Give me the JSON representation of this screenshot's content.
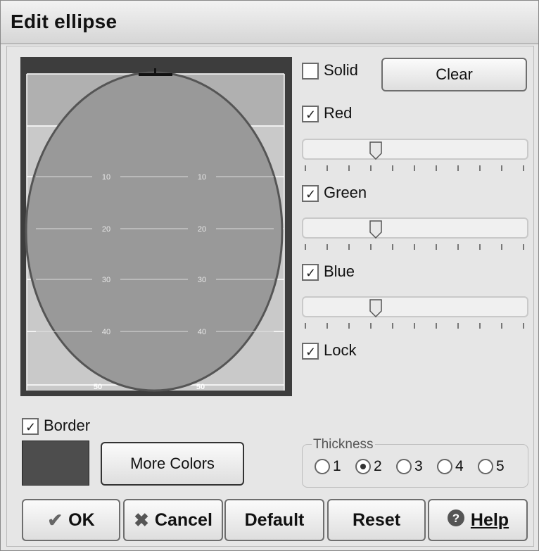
{
  "window": {
    "title": "Edit ellipse"
  },
  "preview": {
    "background_color": "#3d3d3d",
    "ellipse_fill": "#999999",
    "ellipse_border_color": "#555555",
    "grid_labels_left": [
      "10",
      "20",
      "30",
      "40",
      "50"
    ],
    "grid_labels_right": [
      "10",
      "20",
      "30",
      "40",
      "50"
    ]
  },
  "solid": {
    "label": "Solid",
    "checked": false
  },
  "clear_button": {
    "label": "Clear"
  },
  "red": {
    "label": "Red",
    "checked": true,
    "value": 0.31
  },
  "green": {
    "label": "Green",
    "checked": true,
    "value": 0.31
  },
  "blue": {
    "label": "Blue",
    "checked": true,
    "value": 0.31
  },
  "lock": {
    "label": "Lock",
    "checked": true
  },
  "border": {
    "label": "Border",
    "checked": true,
    "color": "#4d4d4d"
  },
  "more_colors_button": {
    "label": "More Colors"
  },
  "thickness": {
    "title": "Thickness",
    "options": [
      "1",
      "2",
      "3",
      "4",
      "5"
    ],
    "selected": "2"
  },
  "buttons": {
    "ok": {
      "label": "OK",
      "icon": "check-icon"
    },
    "cancel": {
      "label": "Cancel",
      "icon": "x-icon"
    },
    "default": {
      "label": "Default"
    },
    "reset": {
      "label": "Reset"
    },
    "help": {
      "label": "Help",
      "icon": "help-icon"
    }
  }
}
